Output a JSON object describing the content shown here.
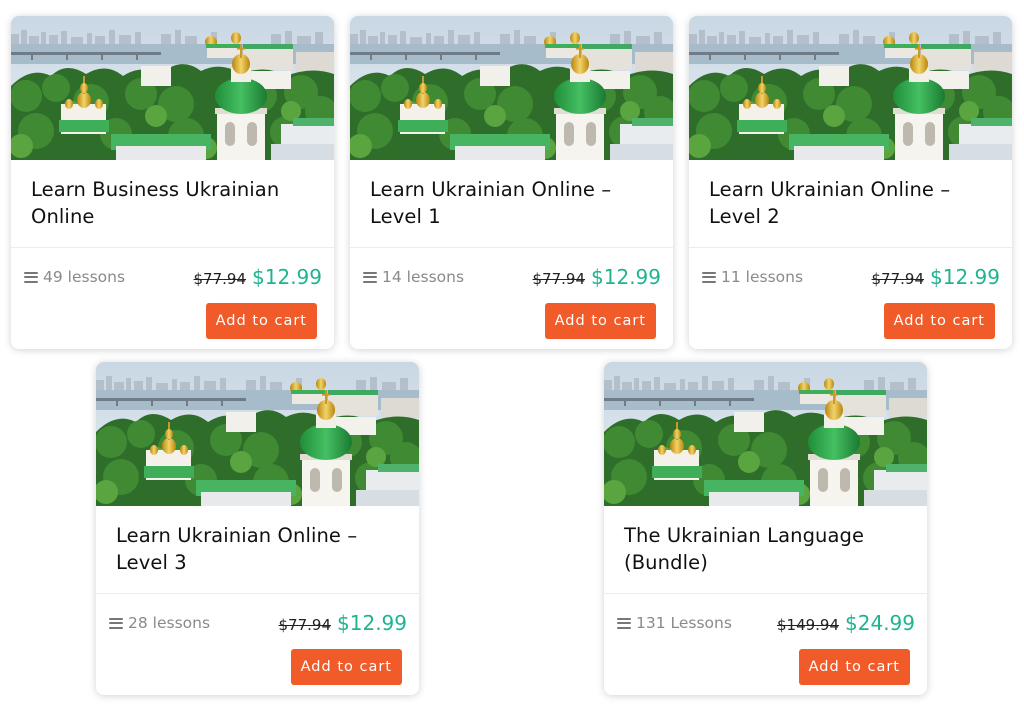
{
  "courses": [
    {
      "title": "Learn Business Ukrainian Online",
      "lessons": "49 lessons",
      "old_price": "$77.94",
      "price": "$12.99",
      "cta": "Add to cart"
    },
    {
      "title": "Learn Ukrainian Online – Level 1",
      "lessons": "14 lessons",
      "old_price": "$77.94",
      "price": "$12.99",
      "cta": "Add to cart"
    },
    {
      "title": "Learn Ukrainian Online – Level 2",
      "lessons": "11 lessons",
      "old_price": "$77.94",
      "price": "$12.99",
      "cta": "Add to cart"
    },
    {
      "title": "Learn Ukrainian Online – Level 3",
      "lessons": "28 lessons",
      "old_price": "$77.94",
      "price": "$12.99",
      "cta": "Add to cart"
    },
    {
      "title": "The Ukrainian Language (Bundle)",
      "lessons": "131 Lessons",
      "old_price": "$149.94",
      "price": "$24.99",
      "cta": "Add to cart"
    }
  ],
  "colors": {
    "accent_button": "#f15a29",
    "sale_price": "#1fb390",
    "lesson_text": "#8a8a8a"
  },
  "icons": {
    "lesson_count": "menu-lines-icon"
  }
}
